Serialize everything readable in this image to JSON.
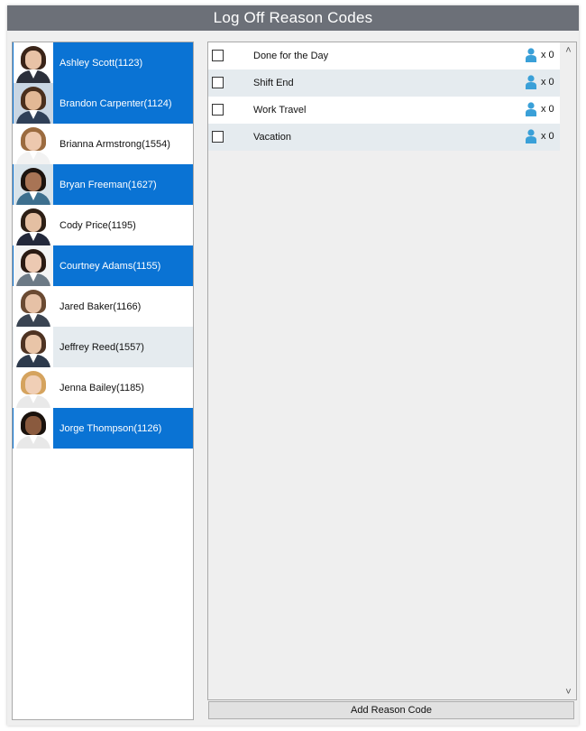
{
  "window": {
    "title": "Log Off Reason Codes"
  },
  "users": [
    {
      "name": "Ashley Scott(1123)",
      "state": "selected",
      "skin": "#e8c2a6",
      "hair": "#3a2418",
      "shirt": "#2b2f3a",
      "bg": "#ffffff"
    },
    {
      "name": "Brandon Carpenter(1124)",
      "state": "selected",
      "skin": "#e2b895",
      "hair": "#4a2f1c",
      "shirt": "#2f4058",
      "bg": "#c9d6e3"
    },
    {
      "name": "Brianna Armstrong(1554)",
      "state": "normal",
      "skin": "#edc8ae",
      "hair": "#9b6b3f",
      "shirt": "#f2f2f2",
      "bg": "#ffffff"
    },
    {
      "name": "Bryan Freeman(1627)",
      "state": "selected",
      "skin": "#a87455",
      "hair": "#1c130e",
      "shirt": "#3d6f8e",
      "bg": "#d8e3ea"
    },
    {
      "name": "Cody Price(1195)",
      "state": "normal",
      "skin": "#e4bfa2",
      "hair": "#2d1f15",
      "shirt": "#23283a",
      "bg": "#ffffff"
    },
    {
      "name": "Courtney Adams(1155)",
      "state": "selected",
      "skin": "#ecc9b2",
      "hair": "#2a1a12",
      "shirt": "#6c7a86",
      "bg": "#f4f4f4"
    },
    {
      "name": "Jared Baker(1166)",
      "state": "normal",
      "skin": "#e6c1a6",
      "hair": "#6a4a32",
      "shirt": "#3a4452",
      "bg": "#ffffff"
    },
    {
      "name": "Jeffrey Reed(1557)",
      "state": "hover",
      "skin": "#e9c5a8",
      "hair": "#4e3322",
      "shirt": "#2d3a4c",
      "bg": "#ffffff"
    },
    {
      "name": "Jenna Bailey(1185)",
      "state": "normal",
      "skin": "#f0cfb6",
      "hair": "#d5a35e",
      "shirt": "#e9e9e9",
      "bg": "#ffffff"
    },
    {
      "name": "Jorge Thompson(1126)",
      "state": "selected",
      "skin": "#8a5a3e",
      "hair": "#1a120d",
      "shirt": "#e8e8e8",
      "bg": "#ffffff"
    }
  ],
  "reason_codes": [
    {
      "label": "Done for the Day",
      "count": "x 0"
    },
    {
      "label": "Shift End",
      "count": "x 0"
    },
    {
      "label": "Work Travel",
      "count": "x 0"
    },
    {
      "label": "Vacation",
      "count": "x 0"
    }
  ],
  "scrollbar": {
    "up_glyph": "˄",
    "down_glyph": "˅"
  },
  "buttons": {
    "add_reason_code": "Add Reason Code"
  },
  "colors": {
    "title_bg": "#6c7078",
    "selected_bg": "#0a73d4",
    "hover_bg": "#e5ebef",
    "person_icon": "#3aa0d8"
  }
}
